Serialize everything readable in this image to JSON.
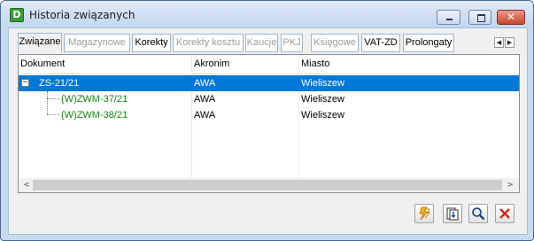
{
  "window": {
    "title": "Historia związanych",
    "app_icon_letter": "D",
    "close_glyph": "✕"
  },
  "tabs": [
    {
      "label": "Związane",
      "state": "active"
    },
    {
      "label": "Magazynowe",
      "state": "disabled"
    },
    {
      "label": "Korekty",
      "state": "enabled"
    },
    {
      "label": "Korekty kosztu",
      "state": "disabled"
    },
    {
      "label": "Kaucje",
      "state": "disabled"
    },
    {
      "label": "PKJ",
      "state": "disabled"
    },
    {
      "label": "Księgowe",
      "state": "disabled"
    },
    {
      "label": "VAT-ZD",
      "state": "enabled"
    },
    {
      "label": "Prolongaty",
      "state": "enabled"
    }
  ],
  "tab_scroll": {
    "left": "◀",
    "right": "▶"
  },
  "grid": {
    "columns": [
      "Dokument",
      "Akronim",
      "Miasto"
    ],
    "tree_toggle": "−",
    "rows": [
      {
        "dokument": "ZS-21/21",
        "akronim": "AWA",
        "miasto": "Wieliszew",
        "selected": true,
        "level": 0
      },
      {
        "dokument": "(W)ZWM-37/21",
        "akronim": "AWA",
        "miasto": "Wieliszew",
        "selected": false,
        "level": 1
      },
      {
        "dokument": "(W)ZWM-38/21",
        "akronim": "AWA",
        "miasto": "Wieliszew",
        "selected": false,
        "level": 1
      }
    ],
    "scroll_left": "<",
    "scroll_right": ">"
  },
  "actions": [
    {
      "name": "lightning-icon"
    },
    {
      "name": "export-document-icon"
    },
    {
      "name": "magnifier-icon"
    },
    {
      "name": "red-x-icon"
    }
  ],
  "colors": {
    "selection": "#0078d7",
    "child_doc_text": "#138a13",
    "disabled_tab_text": "#9e9e9e"
  }
}
